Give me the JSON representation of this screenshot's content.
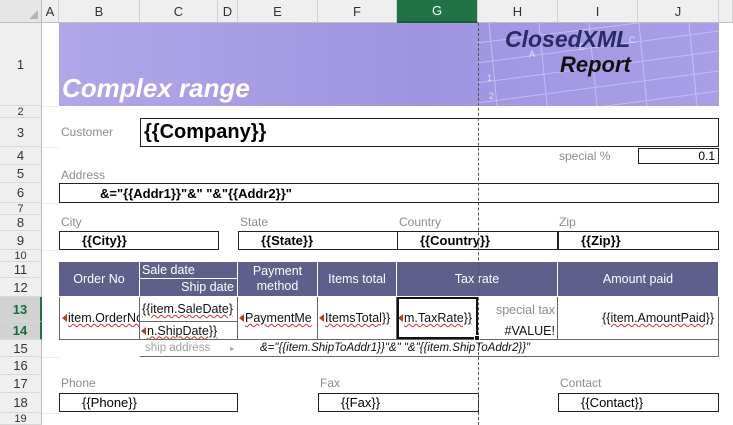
{
  "columns": [
    "A",
    "B",
    "C",
    "D",
    "E",
    "F",
    "G",
    "H",
    "I",
    "J"
  ],
  "selected_column": "G",
  "rows": [
    "1",
    "2",
    "3",
    "4",
    "5",
    "6",
    "7",
    "8",
    "9",
    "10",
    "11",
    "12",
    "13",
    "14",
    "15",
    "16",
    "17",
    "18",
    "19"
  ],
  "selected_rows": [
    "13",
    "14"
  ],
  "banner": {
    "title": "Complex range",
    "logo_line1": "ClosedXML",
    "logo_line2": "Report",
    "logo_grid_letters": [
      "A",
      "B",
      "C"
    ],
    "logo_grid_numbers": [
      "1",
      "2"
    ]
  },
  "form": {
    "customer_label": "Customer",
    "company": "{{Company}}",
    "special_label": "special %",
    "special_value": "0.1",
    "address_label": "Address",
    "address_formula": "&=\"{{Addr1}}\"&\" \"&\"{{Addr2}}\"",
    "city_label": "City",
    "state_label": "State",
    "country_label": "Country",
    "zip_label": "Zip",
    "city": "{{City}}",
    "state": "{{State}}",
    "country": "{{Country}}",
    "zip": "{{Zip}}"
  },
  "table": {
    "headers": {
      "order_no": "Order No",
      "sale_date": "Sale date",
      "ship_date": "Ship date",
      "payment_method": "Payment method",
      "items_total": "Items total",
      "tax_rate": "Tax rate",
      "amount_paid": "Amount paid"
    },
    "row": {
      "order_no": "item.OrderNo",
      "sale_date": "{{item.SaleDate}",
      "ship_date": "n.ShipDate}}",
      "payment": "PaymentMe",
      "items_total": "ItemsTotal}}",
      "tax_rate": "m.TaxRate}}",
      "special_tax": "special tax",
      "value_error": "#VALUE!",
      "amount_paid": "{{item.AmountPaid}}",
      "ship_address_label": "ship address",
      "ship_address_formula": "&=\"{{item.ShipToAddr1}}\"&\" \"&\"{{item.ShipToAddr2}}\""
    }
  },
  "footer": {
    "phone_label": "Phone",
    "fax_label": "Fax",
    "contact_label": "Contact",
    "phone": "{{Phone}}",
    "fax": "{{Fax}}",
    "contact": "{{Contact}}"
  },
  "colors": {
    "banner": "#a59be5",
    "table_header": "#5f5f8c",
    "selection": "#217346"
  }
}
